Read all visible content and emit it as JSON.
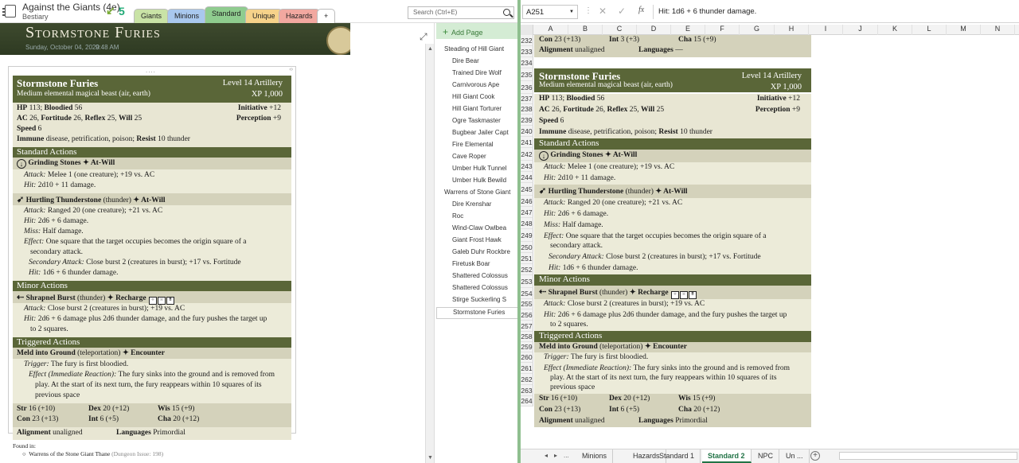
{
  "onenote": {
    "notebook_title": "Against the Giants (4e)",
    "notebook_sub": "Bestiary",
    "back_count": "5",
    "sections": [
      {
        "label": "Giants",
        "color": "#c9e3a6"
      },
      {
        "label": "Minions",
        "color": "#a9c8ee"
      },
      {
        "label": "Standard",
        "color": "#8fcc8f"
      },
      {
        "label": "Unique",
        "color": "#f6d28a"
      },
      {
        "label": "Hazards",
        "color": "#f2a8a0"
      },
      {
        "label": "+",
        "color": "#ffffff"
      }
    ],
    "search_placeholder": "Search (Ctrl+E)",
    "page_title": "Stormstone Furies",
    "page_date": "Sunday, October 04, 2020",
    "page_time": "9:48 AM",
    "container_handle": "....",
    "add_page": "Add Page",
    "pages": [
      "Steading of Hill Giant",
      "Dire Bear",
      "Trained Dire Wolf",
      "Carnivorous Ape",
      "Hill Giant Cook",
      "Hill Giant Torturer",
      "Ogre Taskmaster",
      "Bugbear Jailer Capt",
      "Fire Elemental",
      "Cave Roper",
      "Umber Hulk Tunnel",
      "Umber Hulk Bewild",
      "Warrens of Stone Giant",
      "Dire Krenshar",
      "Roc",
      "Wind-Claw Owlbea",
      "Giant Frost Hawk",
      "Galeb Duhr Rockbre",
      "Firetusk Boar",
      "Shattered Colossus",
      "Shattered Colossus",
      "Stirge Suckerling S",
      "Stormstone Furies"
    ],
    "found_in_label": "Found in:",
    "found_in_item": "Warrens of the Stone Giant Thane",
    "found_in_note": "(Dungeon Issue: 198)"
  },
  "statblock": {
    "name": "Stormstone Furies",
    "level": "Level 14 Artillery",
    "type": "Medium elemental magical beast (air, earth)",
    "xp": "XP 1,000",
    "hp_label": "HP",
    "hp": "113; ",
    "bloodied_label": "Bloodied",
    "bloodied": "56",
    "initiative_label": "Initiative",
    "initiative": "+12",
    "ac_label": "AC",
    "ac": "26, ",
    "fort_label": "Fortitude",
    "fort": "26, ",
    "ref_label": "Reflex",
    "ref": "25, ",
    "will_label": "Will",
    "will": "25",
    "perception_label": "Perception",
    "perception": "+9",
    "speed_label": "Speed",
    "speed": "6",
    "immune_label": "Immune",
    "immune": "disease, petrification, poison; ",
    "resist_label": "Resist",
    "resist": "10 thunder",
    "standard_actions": "Standard Actions",
    "p1_name": "Grinding Stones",
    "p1_usage": "✦ At-Will",
    "p1_attack_label": "Attack:",
    "p1_attack": "Melee 1 (one creature); +19 vs. AC",
    "p1_hit_label": "Hit:",
    "p1_hit": "2d10 + 11 damage.",
    "p2_name": "Hurtling Thunderstone",
    "p2_keyword": "(thunder)",
    "p2_usage": "✦ At-Will",
    "p2_attack_label": "Attack:",
    "p2_attack": "Ranged 20 (one creature); +21 vs. AC",
    "p2_hit_label": "Hit:",
    "p2_hit": "2d6 + 6 damage.",
    "p2_miss_label": "Miss:",
    "p2_miss": "Half damage.",
    "p2_effect_label": "Effect:",
    "p2_effect1": "One square that the target occupies becomes the origin square of a",
    "p2_effect2": "secondary attack.",
    "p2_sec_label": "Secondary Attack:",
    "p2_sec": "Close burst 2 (creatures in burst); +17 vs. Fortitude",
    "p2_sec_hit_label": "Hit:",
    "p2_sec_hit": "1d6 + 6 thunder damage.",
    "minor_actions": "Minor Actions",
    "p3_name": "Shrapnel Burst",
    "p3_keyword": "(thunder)",
    "p3_usage": "✦ Recharge",
    "p3_attack_label": "Attack:",
    "p3_attack": "Close burst 2 (creatures in burst); +19 vs. AC",
    "p3_hit_label": "Hit:",
    "p3_hit1": "2d6 + 6 damage plus 2d6 thunder damage, and the fury pushes the target up",
    "p3_hit2": "to 2 squares.",
    "triggered_actions": "Triggered Actions",
    "p4_name": "Meld into Ground",
    "p4_keyword": "(teleportation)",
    "p4_usage": "✦ Encounter",
    "p4_trigger_label": "Trigger:",
    "p4_trigger": "The fury is first bloodied.",
    "p4_effect_label": "Effect (Immediate Reaction):",
    "p4_effect1": "The fury sinks into the ground and is removed from",
    "p4_effect2": "play. At the start of its next turn, the fury reappears within 10 squares of its",
    "p4_effect3": "previous space",
    "str_label": "Str",
    "str": "16 (+10)",
    "dex_label": "Dex",
    "dex": "20 (+12)",
    "wis_label": "Wis",
    "wis": "15 (+9)",
    "con_label": "Con",
    "con": "23 (+13)",
    "int_label": "Int",
    "int": "6 (+5)",
    "cha_label": "Cha",
    "cha": "20 (+12)",
    "align_label": "Alignment",
    "align": "unaligned",
    "lang_label": "Languages",
    "lang": "Primordial",
    "lang_none": "—"
  },
  "excel": {
    "name_box": "A251",
    "formula": "Hit: 1d6 + 6 thunder damage.",
    "fx": "fx",
    "columns": [
      "A",
      "B",
      "C",
      "D",
      "E",
      "F",
      "G",
      "H",
      "I",
      "J",
      "K",
      "L",
      "M",
      "N"
    ],
    "row_numbers": [
      "232",
      "233",
      "234",
      "235",
      "236",
      "237",
      "238",
      "239",
      "240",
      "241",
      "242",
      "243",
      "244",
      "245",
      "246",
      "247",
      "248",
      "249",
      "250",
      "251",
      "252",
      "253",
      "254",
      "255",
      "256",
      "257",
      "258",
      "259",
      "260",
      "261",
      "262",
      "263",
      "264"
    ],
    "sheets": [
      "Minions",
      "Hazards",
      "Standard 1",
      "Standard 2",
      "NPC",
      "Un ..."
    ],
    "active_sheet": "Standard 2",
    "nav_prev": "◂",
    "nav_next": "▸",
    "nav_more": "...",
    "add_sheet": "+"
  },
  "colors": {
    "header": "#5a6638",
    "body": "#e8e6d3",
    "power": "#d4d2bb",
    "accent": "#217346"
  }
}
